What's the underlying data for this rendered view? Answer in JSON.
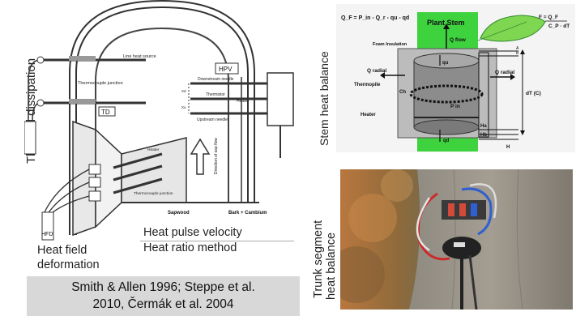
{
  "labels": {
    "thermal_dissipation": "Thermal dissipation",
    "stem_heat_balance": "Stem heat balance",
    "trunk_segment_1": "Trunk segment",
    "trunk_segment_2": "heat balance",
    "heat_pulse_velocity": "Heat pulse velocity",
    "heat_ratio_method": "Heat ratio method",
    "heat_field_1": "Heat field",
    "heat_field_2": "deformation",
    "citation_line1": "Smith & Allen 1996; Steppe et al.",
    "citation_line2": "2010, Čermák et al. 2004"
  },
  "diagram_main": {
    "line_heat_source": "Line heat source",
    "thermocouple_junction": "Thermocouple junction",
    "td": "TD",
    "hpv": "HPV",
    "downstream_needle": "Downstream needle",
    "thermistor": "Thermistor",
    "heater": "Heater",
    "upstream_needle": "Upstream needle",
    "xd": "Xd",
    "xu": "Xu",
    "direction_of_sap_flow": "Direction of sap flow",
    "sapwood": "Sapwood",
    "bark_cambium": "Bark + Cambium",
    "thermocouple_junction_lower": "Thermocouple junction",
    "hfd": "HFD",
    "heater_small": "Heater"
  },
  "diagram_shb": {
    "equation_left": "Q_F = P_in - Q_r - qu - qd",
    "plant_stem": "Plant Stem",
    "equation_right_num": "F = Q_F",
    "equation_right_den": "C_P · dT",
    "foam_insulation": "Foam Insulation",
    "q_flow": "Q flow",
    "q_radial_left": "Q radial",
    "q_radial_right": "Q radial",
    "thermopile": "Thermopile",
    "heater": "Heater",
    "p_in": "P in",
    "qu": "qu",
    "qd": "qd",
    "ch": "Ch",
    "ha": "Ha",
    "hb": "Hb",
    "h": "H",
    "dt_c": "dT (C)",
    "a": "A",
    "b": "B"
  },
  "colors": {
    "citation_bg": "#d8d8d8",
    "stem_green": "#3fd23f",
    "leaf_green": "#7fd650",
    "bark": "#9a938a"
  }
}
